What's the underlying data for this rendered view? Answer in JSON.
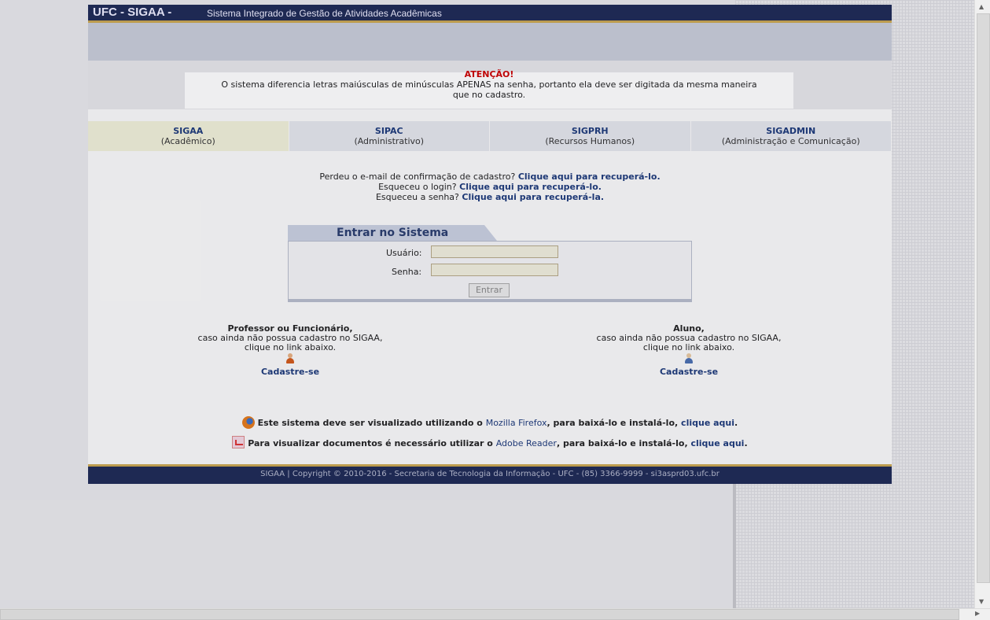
{
  "header": {
    "brand": "UFC - SIGAA -",
    "subtitle": "Sistema Integrado de Gestão de Atividades Acadêmicas"
  },
  "warning": {
    "title": "ATENÇÃO!",
    "line1": "O sistema diferencia letras maiúsculas de minúsculas APENAS na senha, portanto ela deve ser digitada da mesma maneira",
    "line2": "que no cadastro."
  },
  "systems": [
    {
      "name": "SIGAA",
      "desc": "(Acadêmico)",
      "active": true
    },
    {
      "name": "SIPAC",
      "desc": "(Administrativo)",
      "active": false
    },
    {
      "name": "SIGPRH",
      "desc": "(Recursos Humanos)",
      "active": false
    },
    {
      "name": "SIGADMIN",
      "desc": "(Administração e Comunicação)",
      "active": false
    }
  ],
  "recovery": {
    "email_text": "Perdeu o e-mail de confirmação de cadastro?",
    "email_link": "Clique aqui para recuperá-lo.",
    "login_text": "Esqueceu o login?",
    "login_link": "Clique aqui para recuperá-lo.",
    "senha_text": "Esqueceu a senha?",
    "senha_link": "Clique aqui para recuperá-la."
  },
  "login": {
    "title": "Entrar no Sistema",
    "user_label": "Usuário:",
    "user_value": "",
    "pass_label": "Senha:",
    "pass_value": "",
    "submit": "Entrar"
  },
  "register": {
    "staff": {
      "title": "Professor ou Funcionário,",
      "line1": "caso ainda não possua cadastro no SIGAA,",
      "line2": "clique no link abaixo.",
      "link": "Cadastre-se"
    },
    "student": {
      "title": "Aluno,",
      "line1": "caso ainda não possua cadastro no SIGAA,",
      "line2": "clique no link abaixo.",
      "link": "Cadastre-se"
    }
  },
  "notices": {
    "firefox_pre": "Este sistema deve ser visualizado utilizando o",
    "firefox_link": "Mozilla Firefox",
    "firefox_mid": ", para baixá-lo e instalá-lo,",
    "firefox_click": "clique aqui",
    "firefox_end": ".",
    "reader_pre": "Para visualizar documentos é necessário utilizar o",
    "reader_link": "Adobe Reader",
    "reader_mid": ", para baixá-lo e instalá-lo,",
    "reader_click": "clique aqui",
    "reader_end": "."
  },
  "footer": {
    "text": "SIGAA | Copyright © 2010-2016 - Secretaria de Tecnologia da Informação - UFC - (85) 3366-9999 - si3asprd03.ufc.br"
  },
  "colors": {
    "header_bg": "#1e2a55",
    "accent": "#c9a650",
    "link": "#1d3a7a",
    "warning_title": "#cc0000"
  }
}
